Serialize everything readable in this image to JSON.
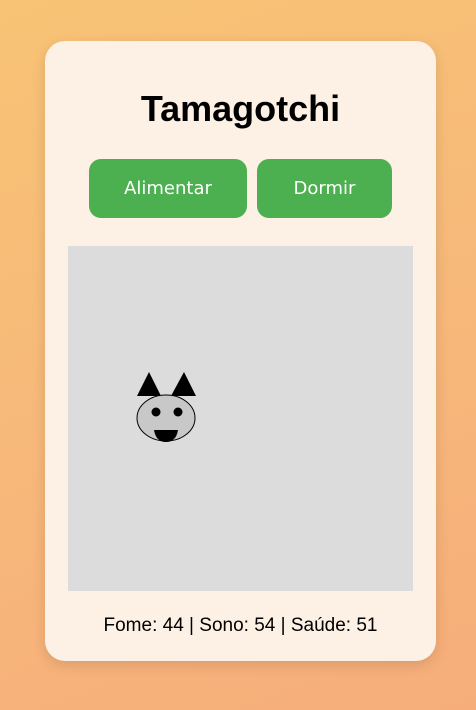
{
  "app": {
    "title": "Tamagotchi"
  },
  "actions": {
    "feed_label": "Alimentar",
    "sleep_label": "Dormir"
  },
  "pet": {
    "icon": "cat-icon"
  },
  "stats": {
    "fome_label": "Fome",
    "fome": 44,
    "sono_label": "Sono",
    "sono": 54,
    "saude_label": "Saúde",
    "saude": 51
  },
  "colors": {
    "button": "#4caf50",
    "card": "#fdf0e4",
    "play_area": "#dcdcdc",
    "pet_face": "#c8c8c8"
  }
}
